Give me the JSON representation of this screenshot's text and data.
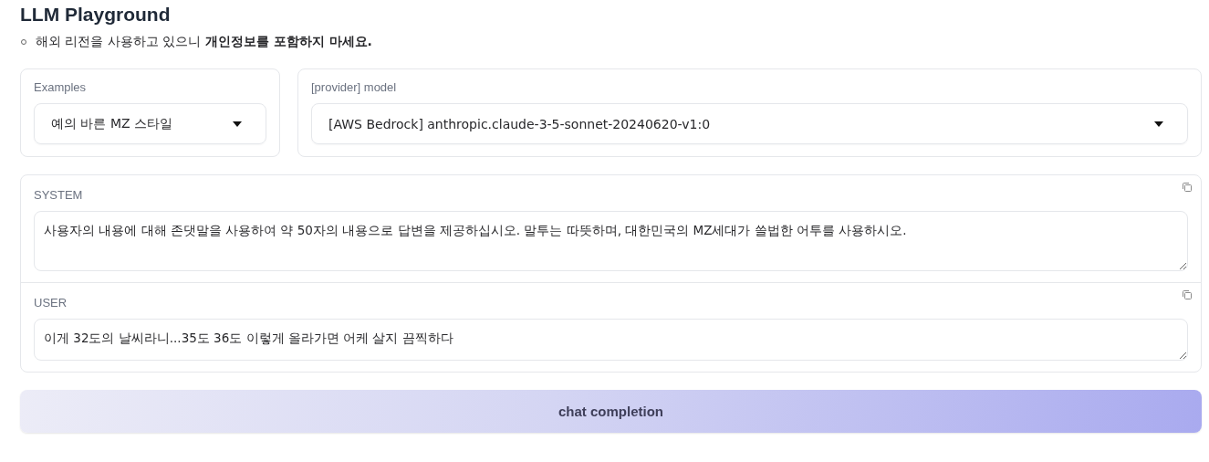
{
  "title": "LLM Playground",
  "notice": "해외 리전을 사용하고 있으니 **개인정보를 포함하지 마세요.**",
  "examples": {
    "label": "Examples",
    "value": "예의 바른 MZ 스타일"
  },
  "model": {
    "label": "[provider] model",
    "value": "[AWS Bedrock] anthropic.claude-3-5-sonnet-20240620-v1:0"
  },
  "messages": [
    {
      "role": "SYSTEM",
      "content": "사용자의 내용에 대해 존댓말을 사용하여 약 50자의 내용으로 답변을 제공하십시오. 말투는 따뜻하며, 대한민국의 MZ세대가 쓸법한 어투를 사용하시오.",
      "kind": "tall"
    },
    {
      "role": "USER",
      "content": "이게 32도의 날씨라니...35도 36도 이렇게 올라가면 어케 살지 끔찍하다",
      "kind": "short"
    }
  ],
  "button": "chat completion"
}
